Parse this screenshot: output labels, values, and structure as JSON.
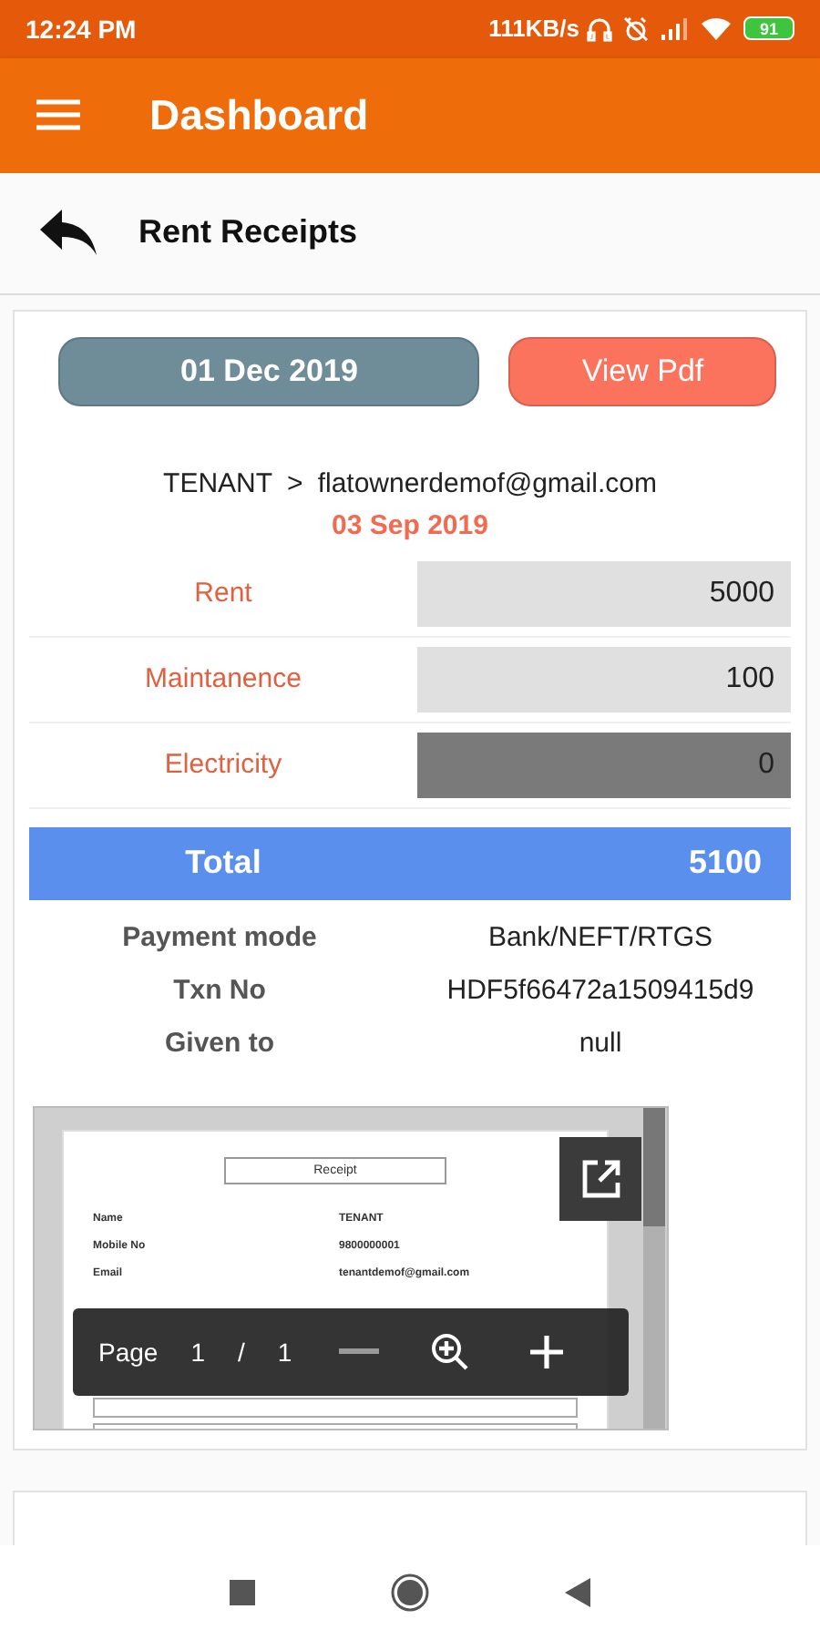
{
  "status_bar": {
    "time": "12:24 PM",
    "speed": "111KB/s",
    "battery": "91"
  },
  "app_bar": {
    "title": "Dashboard"
  },
  "sub_header": {
    "title": "Rent Receipts"
  },
  "receipt": {
    "date_button": "01 Dec 2019",
    "pdf_button": "View Pdf",
    "from": "TENANT",
    "separator": ">",
    "to": "flatownerdemof@gmail.com",
    "date": "03 Sep 2019",
    "charges": [
      {
        "label": "Rent",
        "value": "5000",
        "disabled": false
      },
      {
        "label": "Maintanence",
        "value": "100",
        "disabled": false
      },
      {
        "label": "Electricity",
        "value": "0",
        "disabled": true
      }
    ],
    "total": {
      "label": "Total",
      "value": "5100"
    },
    "details": [
      {
        "label": "Payment mode",
        "value": "Bank/NEFT/RTGS"
      },
      {
        "label": "Txn No",
        "value": "HDF5f66472a1509415d9"
      },
      {
        "label": "Given to",
        "value": "null"
      }
    ],
    "pdf_preview": {
      "heading": "Receipt",
      "rows": [
        {
          "label": "Name",
          "value": "TENANT"
        },
        {
          "label": "Mobile No",
          "value": "9800000001"
        },
        {
          "label": "Email",
          "value": "tenantdemof@gmail.com"
        }
      ],
      "toolbar": {
        "page_label": "Page",
        "current": "1",
        "slash": "/",
        "total": "1"
      }
    }
  }
}
